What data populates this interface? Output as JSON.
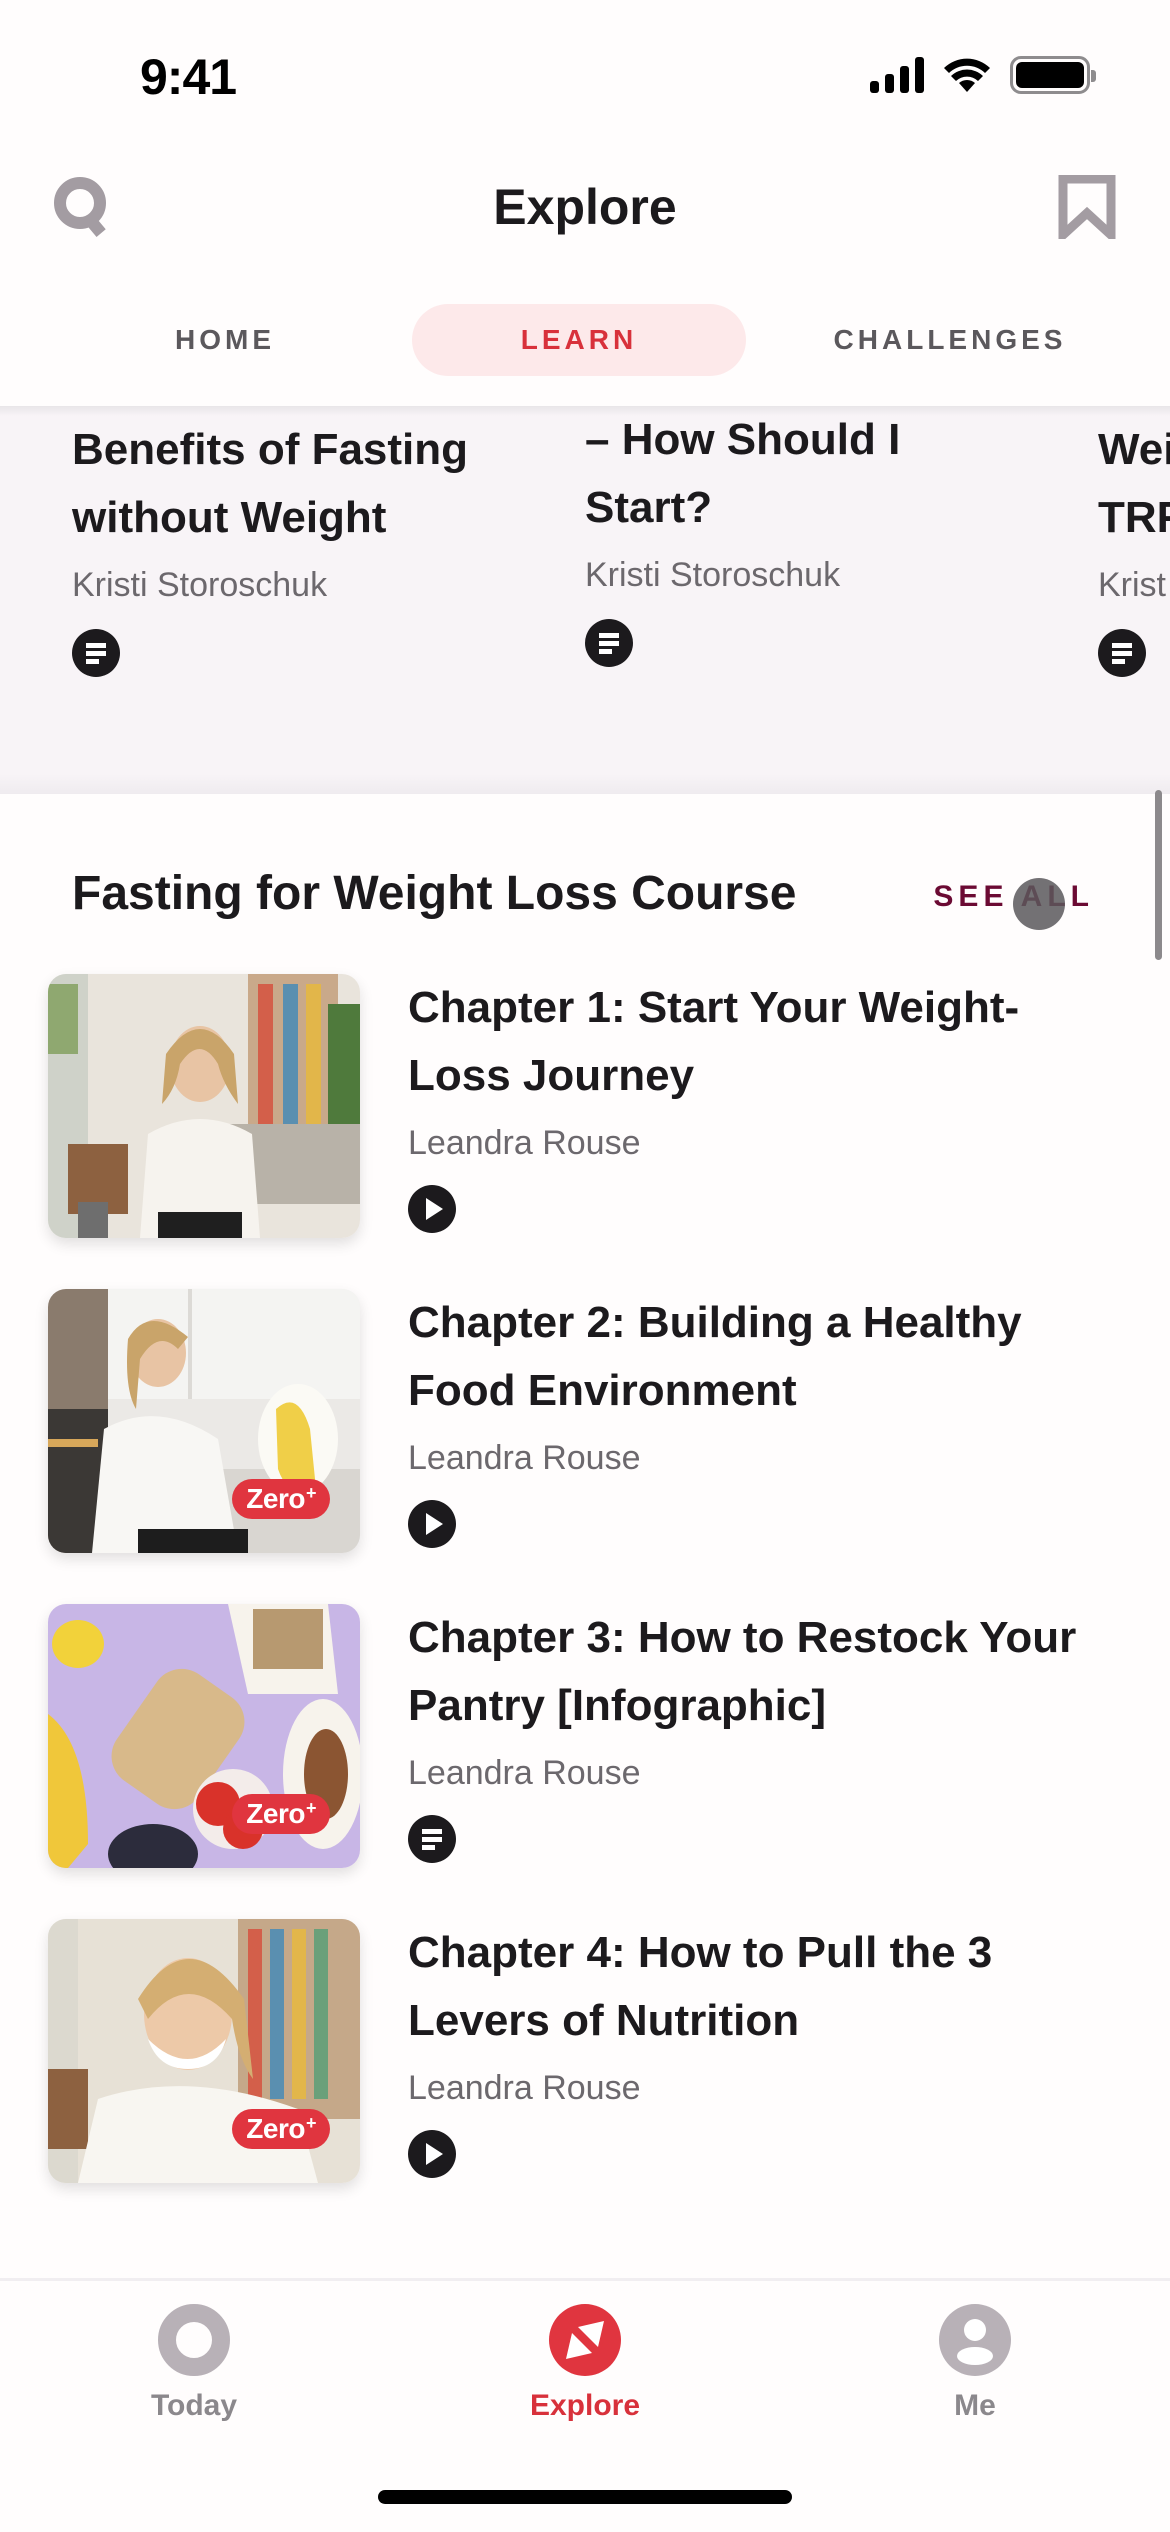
{
  "status_bar": {
    "time": "9:41"
  },
  "header": {
    "title": "Explore",
    "search_icon": "search-icon",
    "bookmark_icon": "bookmark-icon"
  },
  "tabs": [
    {
      "label": "HOME",
      "active": false
    },
    {
      "label": "LEARN",
      "active": true
    },
    {
      "label": "CHALLENGES",
      "active": false
    }
  ],
  "carousel": {
    "cards": [
      {
        "title_lines": [
          "Benefits of Fasting",
          "without Weight"
        ],
        "author": "Kristi Storoschuk",
        "type": "article"
      },
      {
        "title_lines": [
          "– How Should I",
          "Start?"
        ],
        "author": "Kristi Storoschuk",
        "type": "article"
      },
      {
        "title_lines": [
          "Wei",
          "TRF"
        ],
        "author": "Krist",
        "type": "article"
      }
    ]
  },
  "section": {
    "title": "Fasting for Weight Loss Course",
    "see_all_label": "SEE ALL",
    "items": [
      {
        "title_lines": [
          "Chapter 1: Start Your Weight-",
          "Loss Journey"
        ],
        "author": "Leandra Rouse",
        "type": "video",
        "badge": ""
      },
      {
        "title_lines": [
          "Chapter 2: Building a Healthy",
          "Food Environment"
        ],
        "author": "Leandra Rouse",
        "type": "video",
        "badge": "Zero"
      },
      {
        "title_lines": [
          "Chapter 3: How to Restock Your",
          "Pantry [Infographic]"
        ],
        "author": "Leandra Rouse",
        "type": "article",
        "badge": "Zero"
      },
      {
        "title_lines": [
          "Chapter 4: How to Pull the 3",
          "Levers of Nutrition"
        ],
        "author": "Leandra Rouse",
        "type": "video",
        "badge": "Zero"
      }
    ],
    "badge_suffix": "+"
  },
  "bottom_nav": [
    {
      "label": "Today",
      "icon": "ring-icon",
      "active": false
    },
    {
      "label": "Explore",
      "icon": "compass-icon",
      "active": true
    },
    {
      "label": "Me",
      "icon": "profile-icon",
      "active": false
    }
  ],
  "colors": {
    "accent_red": "#d8313b",
    "see_all": "#6b0a33",
    "tab_active_bg": "#fde9ea",
    "icon_gray": "#a39ca2",
    "badge_red": "#e0353f"
  }
}
